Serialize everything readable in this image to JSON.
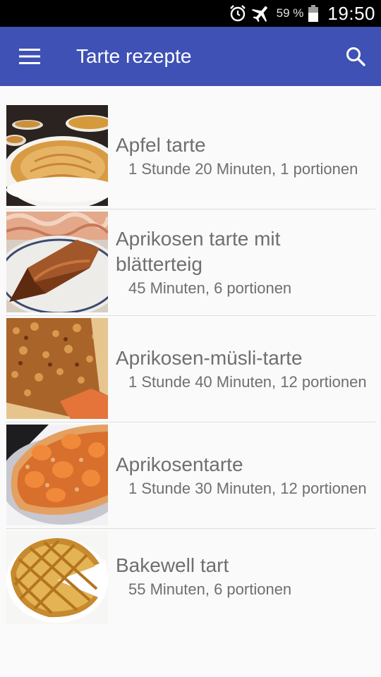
{
  "status_bar": {
    "alarm_icon": "alarm-clock-icon",
    "airplane_icon": "airplane-mode-icon",
    "battery_percent": "59 %",
    "battery_icon": "battery-icon",
    "time": "19:50"
  },
  "app_bar": {
    "title": "Tarte rezepte",
    "menu_icon": "hamburger-menu-icon",
    "search_icon": "search-icon",
    "color": "#3f51b5"
  },
  "recipes": [
    {
      "title": "Apfel tarte",
      "meta": "1 Stunde 20 Minuten, 1 portionen",
      "image": "apple-tart-photo"
    },
    {
      "title": "Aprikosen tarte mit blätterteig",
      "meta": "45 Minuten, 6 portionen",
      "image": "apricot-puff-pastry-tart-photo"
    },
    {
      "title": "Aprikosen-müsli-tarte",
      "meta": "1 Stunde 40 Minuten, 12 portionen",
      "image": "apricot-muesli-tart-photo"
    },
    {
      "title": "Aprikosentarte",
      "meta": "1 Stunde 30 Minuten, 12 portionen",
      "image": "apricot-tart-photo"
    },
    {
      "title": "Bakewell tart",
      "meta": "55 Minuten, 6 portionen",
      "image": "bakewell-tart-photo"
    }
  ]
}
